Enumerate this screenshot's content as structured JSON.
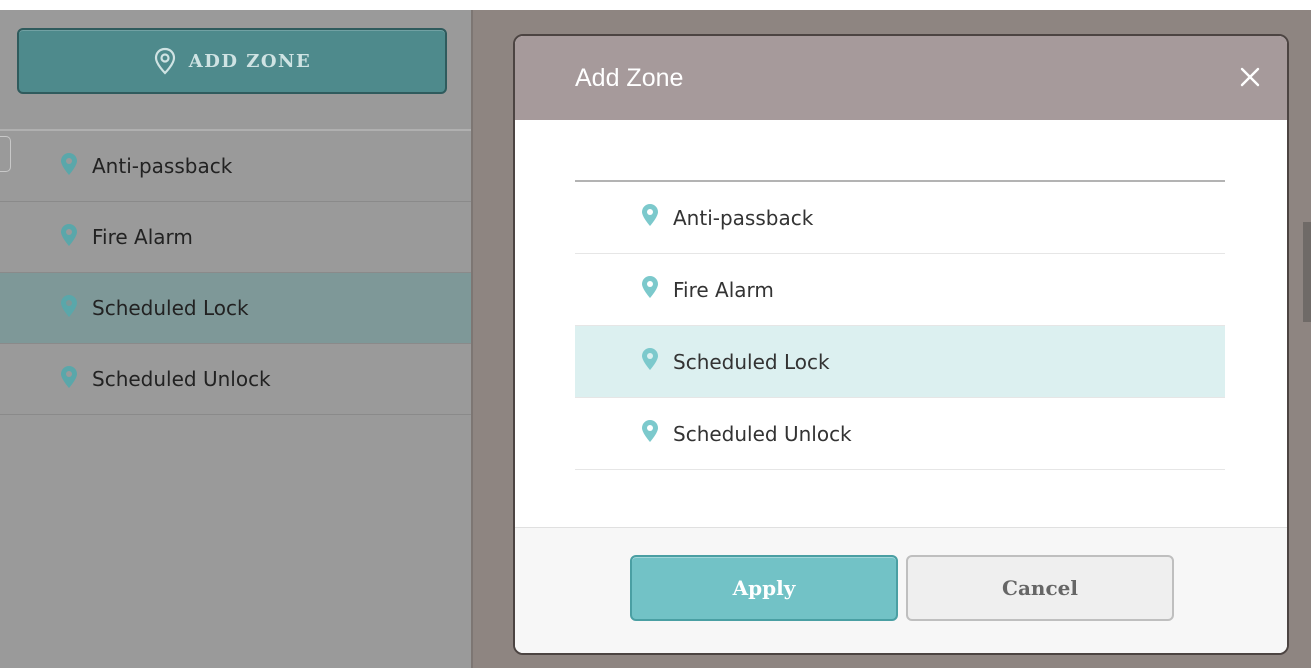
{
  "sidebar": {
    "add_zone_label": "ADD ZONE",
    "items": [
      {
        "label": "Anti-passback"
      },
      {
        "label": "Fire Alarm"
      },
      {
        "label": "Scheduled Lock",
        "selected": true
      },
      {
        "label": "Scheduled Unlock"
      }
    ]
  },
  "modal": {
    "title": "Add Zone",
    "close_icon": "close-icon",
    "items": [
      {
        "label": "Anti-passback"
      },
      {
        "label": "Fire Alarm"
      },
      {
        "label": "Scheduled Lock",
        "selected": true
      },
      {
        "label": "Scheduled Unlock"
      }
    ],
    "apply_label": "Apply",
    "cancel_label": "Cancel"
  },
  "colors": {
    "pin": "#7cc9cc",
    "apply_bg": "#72c2c6",
    "selected_row": "#dcf0f0",
    "header_bg": "#a69a9b"
  }
}
